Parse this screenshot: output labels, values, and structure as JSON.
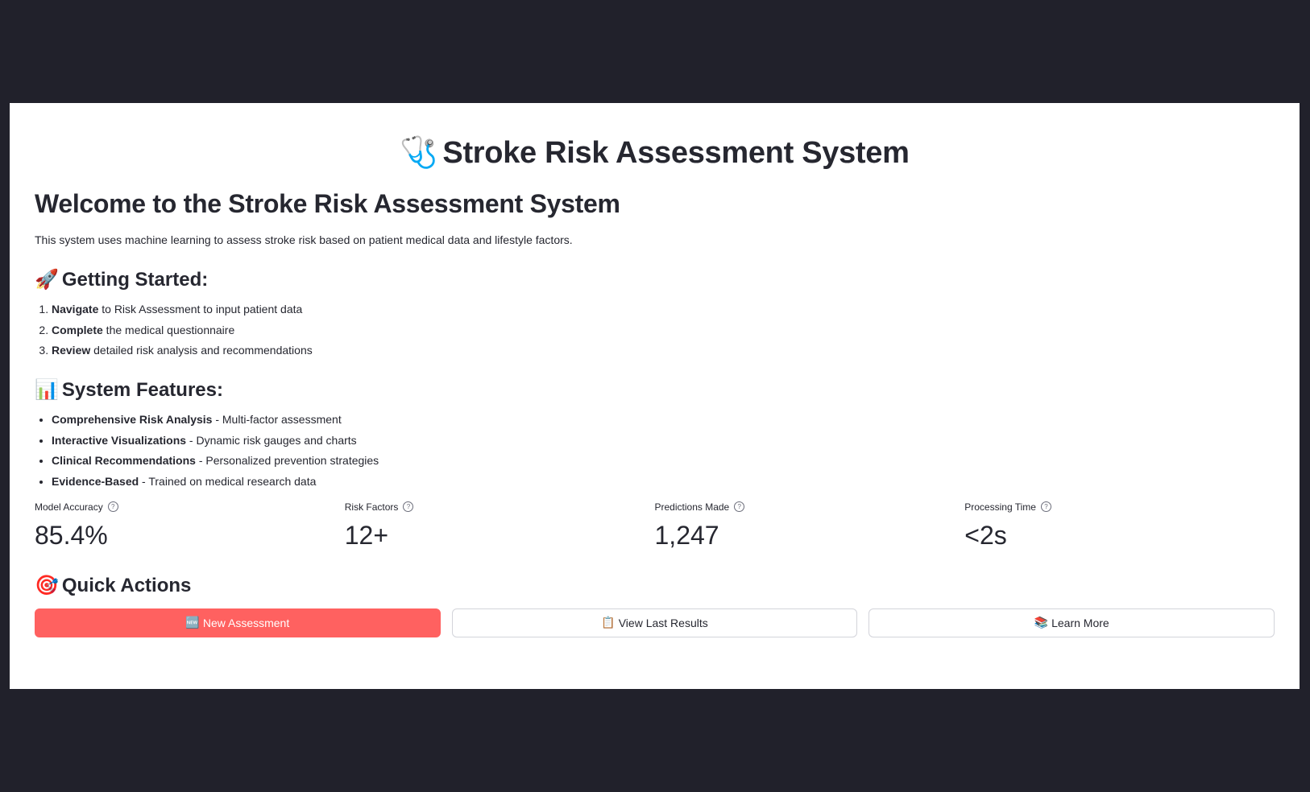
{
  "header": {
    "title_icon": "🩺",
    "title": "Stroke Risk Assessment System"
  },
  "welcome": {
    "heading": "Welcome to the Stroke Risk Assessment System",
    "description": "This system uses machine learning to assess stroke risk based on patient medical data and lifestyle factors."
  },
  "getting_started": {
    "icon": "🚀",
    "heading": "Getting Started:",
    "steps": [
      {
        "bold": "Navigate",
        "text": " to Risk Assessment to input patient data"
      },
      {
        "bold": "Complete",
        "text": " the medical questionnaire"
      },
      {
        "bold": "Review",
        "text": " detailed risk analysis and recommendations"
      }
    ]
  },
  "features": {
    "icon": "📊",
    "heading": "System Features:",
    "items": [
      {
        "bold": "Comprehensive Risk Analysis",
        "text": " - Multi-factor assessment"
      },
      {
        "bold": "Interactive Visualizations",
        "text": " - Dynamic risk gauges and charts"
      },
      {
        "bold": "Clinical Recommendations",
        "text": " - Personalized prevention strategies"
      },
      {
        "bold": "Evidence-Based",
        "text": " - Trained on medical research data"
      }
    ]
  },
  "metrics": [
    {
      "label": "Model Accuracy",
      "value": "85.4%"
    },
    {
      "label": "Risk Factors",
      "value": "12+"
    },
    {
      "label": "Predictions Made",
      "value": "1,247"
    },
    {
      "label": "Processing Time",
      "value": "<2s"
    }
  ],
  "quick_actions": {
    "icon": "🎯",
    "heading": "Quick Actions",
    "buttons": [
      {
        "icon": "🆕",
        "label": "New Assessment"
      },
      {
        "icon": "📋",
        "label": "View Last Results"
      },
      {
        "icon": "📚",
        "label": "Learn More"
      }
    ]
  },
  "help_glyph": "?",
  "colors": {
    "primary": "#ff6160",
    "background": "#21212b",
    "panel": "#ffffff",
    "text": "#262730"
  }
}
